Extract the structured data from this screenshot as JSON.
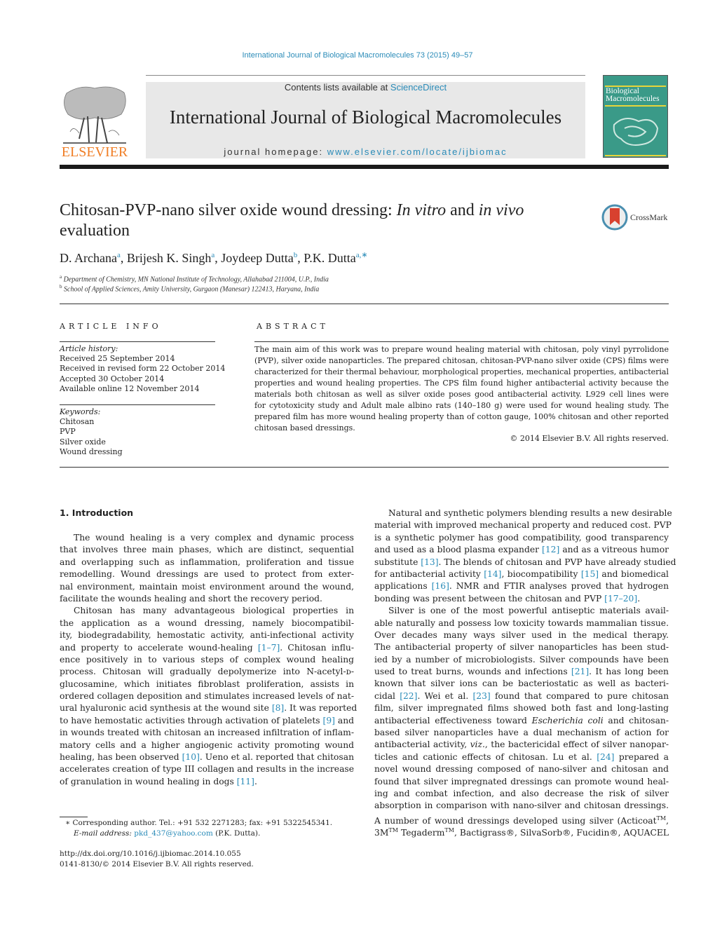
{
  "header": {
    "running_head": "International Journal of Biological Macromolecules 73 (2015) 49–57",
    "contents_prefix": "Contents lists available at ",
    "contents_link": "ScienceDirect",
    "journal_title": "International Journal of Biological Macromolecules",
    "homepage_prefix": "journal homepage: ",
    "homepage_link": "www.elsevier.com/locate/ijbiomac",
    "publisher_logo_text": "ELSEVIER",
    "cover_title_line1": "Biological",
    "cover_title_line2": "Macromolecules",
    "crossmark_label": "CrossMark",
    "colors": {
      "link": "#2a8bb8",
      "elsevier_orange": "#f07e26",
      "cover_teal": "#3a9a88",
      "masthead_gray": "#e8e8e8"
    }
  },
  "article": {
    "title_part1": "Chitosan-PVP-nano silver oxide wound dressing: ",
    "title_italic1": "In vitro",
    "title_part2": " and ",
    "title_italic2": "in vivo",
    "title_line2": "evaluation",
    "authors": [
      {
        "name": "D. Archana",
        "sup": "a"
      },
      {
        "name": "Brijesh K. Singh",
        "sup": "a"
      },
      {
        "name": "Joydeep Dutta",
        "sup": "b"
      },
      {
        "name": "P.K. Dutta",
        "sup": "a,∗"
      }
    ],
    "affiliations": [
      {
        "sup": "a",
        "text": "Department of Chemistry, MN National Institute of Technology, Allahabad 211004, U.P., India"
      },
      {
        "sup": "b",
        "text": "School of Applied Sciences, Amity University, Gurgaon (Manesar) 122413, Haryana, India"
      }
    ]
  },
  "article_info": {
    "heading": "ARTICLE INFO",
    "history_label": "Article history:",
    "history": [
      "Received 25 September 2014",
      "Received in revised form 22 October 2014",
      "Accepted 30 October 2014",
      "Available online 12 November 2014"
    ],
    "keywords_label": "Keywords:",
    "keywords": [
      "Chitosan",
      "PVP",
      "Silver oxide",
      "Wound dressing"
    ]
  },
  "abstract": {
    "heading": "ABSTRACT",
    "lines": [
      "The main aim of this work was to prepare wound healing material with chitosan, poly vinyl pyrrolidone",
      "(PVP), silver oxide nanoparticles. The prepared chitosan, chitosan-PVP-nano silver oxide (CPS) films were",
      "characterized for their thermal behaviour, morphological properties, mechanical properties, antibacterial",
      "properties and wound healing properties. The CPS film found higher antibacterial activity because the",
      "materials both chitosan as well as silver oxide poses good antibacterial activity. L929 cell lines were",
      "for cytotoxicity study and Adult male albino rats (140–180 g) were used for wound healing study. The",
      "prepared film has more wound healing property than of cotton gauge, 100% chitosan and other reported",
      "chitosan based dressings."
    ],
    "copyright": "© 2014 Elsevier B.V. All rights reserved."
  },
  "introduction": {
    "heading": "1.  Introduction",
    "left_lines": [
      {
        "t": "The wound healing is a very complex and dynamic process",
        "indent": true
      },
      {
        "t": "that involves three main phases, which are distinct, sequential"
      },
      {
        "t": "and overlapping such as inflammation, proliferation and tissue"
      },
      {
        "t": "remodelling. Wound dressings are used to protect from exter-"
      },
      {
        "t": "nal environment, maintain moist environment around the wound,"
      },
      {
        "t": "facilitate the wounds healing and short the recovery period.",
        "last": true
      },
      {
        "t": "Chitosan has many advantageous biological properties in",
        "indent": true
      },
      {
        "t": "the application as a wound dressing, namely biocompatibil-"
      },
      {
        "t": "ity, biodegradability, hemostatic activity, anti-infectional activity"
      },
      {
        "t": "and property to accelerate wound-healing ",
        "ref": "[1–7]",
        "after": ". Chitosan influ-"
      },
      {
        "t": "ence positively in to various steps of complex wound healing"
      },
      {
        "t": "process. Chitosan will gradually depolymerize into N-acetyl-ᴅ-"
      },
      {
        "t": "glucosamine, which initiates fibroblast proliferation, assists in"
      },
      {
        "t": "ordered collagen deposition and stimulates increased levels of nat-"
      },
      {
        "t": "ural hyaluronic acid synthesis at the wound site ",
        "ref": "[8]",
        "after": ". It was reported"
      },
      {
        "t": "to have hemostatic activities through activation of platelets ",
        "ref": "[9]",
        "after": " and"
      },
      {
        "t": "in wounds treated with chitosan an increased infiltration of inflam-"
      },
      {
        "t": "matory cells and a higher angiogenic activity promoting wound"
      },
      {
        "t": "healing, has been observed ",
        "ref": "[10]",
        "after": ". Ueno et al. reported that chitosan"
      },
      {
        "t": "accelerates creation of type III collagen and results in the increase"
      },
      {
        "t": "of granulation in wound healing in dogs ",
        "ref": "[11]",
        "after": ".",
        "last": true
      }
    ],
    "right_lines": [
      {
        "t": "Natural and synthetic polymers blending results a new desirable",
        "indent": true
      },
      {
        "t": "material with improved mechanical property and reduced cost. PVP"
      },
      {
        "t": "is a synthetic polymer has good compatibility, good transparency"
      },
      {
        "t": "and used as a blood plasma expander ",
        "ref": "[12]",
        "after": " and as a vitreous humor"
      },
      {
        "t": "substitute ",
        "ref": "[13]",
        "after": ". The blends of chitosan and PVP have already studied"
      },
      {
        "t": "for antibacterial activity ",
        "ref": "[14]",
        "after": ", biocompatibility ",
        "ref2": "[15]",
        "after2": " and biomedical"
      },
      {
        "t": "applications ",
        "ref": "[16]",
        "after": ". NMR and FTIR analyses proved that hydrogen"
      },
      {
        "t": "bonding was present between the chitosan and PVP ",
        "ref": "[17–20]",
        "after": ".",
        "last": true
      },
      {
        "t": "Silver is one of the most powerful antiseptic materials avail-",
        "indent": true
      },
      {
        "t": "able naturally and possess low toxicity towards mammalian tissue."
      },
      {
        "t": "Over decades many ways silver used in the medical therapy."
      },
      {
        "t": "The antibacterial property of silver nanoparticles has been stud-"
      },
      {
        "t": "ied by a number of microbiologists. Silver compounds have been"
      },
      {
        "t": "used to treat burns, wounds and infections ",
        "ref": "[21]",
        "after": ". It has long been"
      },
      {
        "t": "known that silver ions can be bacteriostatic as well as bacteri-"
      },
      {
        "t": "cidal ",
        "ref": "[22]",
        "after": ". Wei et al. ",
        "ref2": "[23]",
        "after2": " found that compared to pure chitosan"
      },
      {
        "t": "film, silver impregnated films showed both fast and long-lasting"
      },
      {
        "t": "antibacterial effectiveness toward ",
        "it": "Escherichia coli",
        "after": " and chitosan-"
      },
      {
        "t": "based silver nanoparticles have a dual mechanism of action for"
      },
      {
        "t": "antibacterial activity, ",
        "it": "viz.",
        "after": ", the bactericidal effect of silver nanopar-"
      },
      {
        "t": "ticles and cationic effects of chitosan. Lu et al. ",
        "ref": "[24]",
        "after": " prepared a"
      },
      {
        "t": "novel wound dressing composed of nano-silver and chitosan and"
      },
      {
        "t": "found that silver impregnated dressings can promote wound heal-"
      },
      {
        "t": "ing and combat infection, and also decrease the risk of silver"
      },
      {
        "t": "absorption in comparison with nano-silver and chitosan dressings."
      },
      {
        "t": "A number of wound dressings developed using silver (Acticoat",
        "sup": "TM",
        "after": ","
      },
      {
        "t": "3M",
        "sup": "TM",
        "after": " Tegaderm",
        "sup2": "TM",
        "after2": ", Bactigrass®, SilvaSorb®, Fucidin®, AQUACEL"
      }
    ]
  },
  "footnotes": {
    "corresponding": "∗  Corresponding author. Tel.: +91 532 2271283; fax: +91 5322545341.",
    "email_label": "E-mail address: ",
    "email": "pkd_437@yahoo.com",
    "email_after": " (P.K. Dutta).",
    "doi": "http://dx.doi.org/10.1016/j.ijbiomac.2014.10.055",
    "issn_copyright": "0141-8130/© 2014 Elsevier B.V. All rights reserved."
  }
}
